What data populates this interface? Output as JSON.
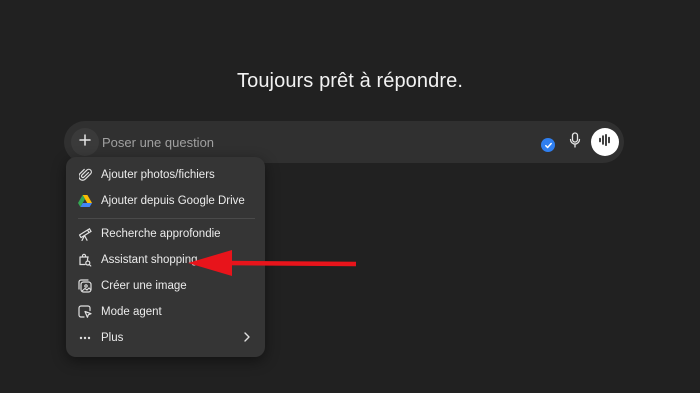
{
  "main": {
    "heading": "Toujours prêt à répondre."
  },
  "composer": {
    "placeholder": "Poser une question",
    "icons": [
      "plus-icon",
      "check-badge-icon",
      "microphone-icon",
      "voice-mode-icon"
    ]
  },
  "menu": {
    "items": [
      {
        "label": "Ajouter photos/fichiers",
        "icon": "paperclip-icon"
      },
      {
        "label": "Ajouter depuis Google Drive",
        "icon": "google-drive-icon"
      },
      {
        "label": "Recherche approfondie",
        "icon": "telescope-icon"
      },
      {
        "label": "Assistant shopping",
        "icon": "shopping-search-icon"
      },
      {
        "label": "Créer une image",
        "icon": "image-create-icon"
      },
      {
        "label": "Mode agent",
        "icon": "agent-cursor-icon"
      },
      {
        "label": "Plus",
        "icon": "ellipsis-icon"
      }
    ]
  },
  "colors": {
    "background": "#212121",
    "composer": "#303030",
    "menu": "#353535",
    "accent_blue": "#2f7ff0",
    "annotation_arrow": "#e8141b"
  }
}
